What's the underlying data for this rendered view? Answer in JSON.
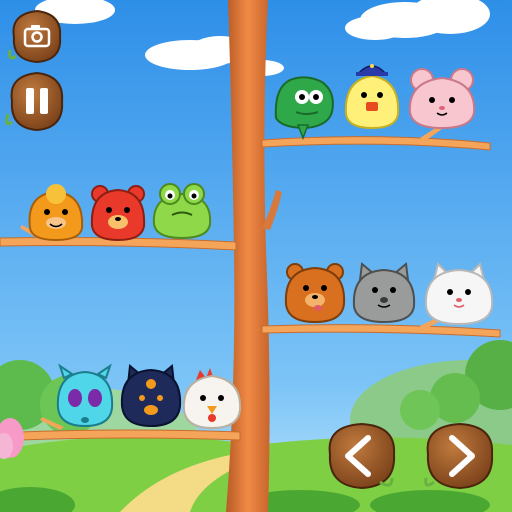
{
  "game": {
    "buttons": [
      {
        "name": "camera-button",
        "icon": "camera-icon"
      },
      {
        "name": "pause-button",
        "icon": "pause-icon"
      },
      {
        "name": "left-arrow-button",
        "icon": "chevron-left-icon"
      },
      {
        "name": "right-arrow-button",
        "icon": "chevron-right-icon"
      }
    ],
    "branches": [
      {
        "name": "branch-top-right",
        "side": "right",
        "characters": [
          {
            "kind": "green-snake",
            "color": "#2fa84a"
          },
          {
            "kind": "yellow-police-chick",
            "color": "#fff07a"
          },
          {
            "kind": "pink-mouse",
            "color": "#f7c6cf"
          }
        ]
      },
      {
        "name": "branch-middle-left",
        "side": "left",
        "characters": [
          {
            "kind": "orange-lion",
            "color": "#f39a1c"
          },
          {
            "kind": "red-bear",
            "color": "#e8392a"
          },
          {
            "kind": "green-frog",
            "color": "#8fd84a"
          }
        ]
      },
      {
        "name": "branch-middle-right",
        "side": "right",
        "characters": [
          {
            "kind": "brown-bear",
            "color": "#d9701f"
          },
          {
            "kind": "gray-cat",
            "color": "#9a9c9c"
          },
          {
            "kind": "white-cat",
            "color": "#f6f6f6"
          }
        ]
      },
      {
        "name": "branch-bottom-left",
        "side": "left",
        "characters": [
          {
            "kind": "cyan-bug",
            "color": "#4fd6e8"
          },
          {
            "kind": "navy-cat",
            "color": "#1d2a5a"
          },
          {
            "kind": "white-chicken",
            "color": "#f7f3ee"
          }
        ]
      }
    ],
    "colors": {
      "sky": "#3fa2f0",
      "grass": "#7fcf45",
      "branch": "#f5a55a",
      "trunk": "#d8793b",
      "wood_button": "#9b5a2a"
    }
  }
}
